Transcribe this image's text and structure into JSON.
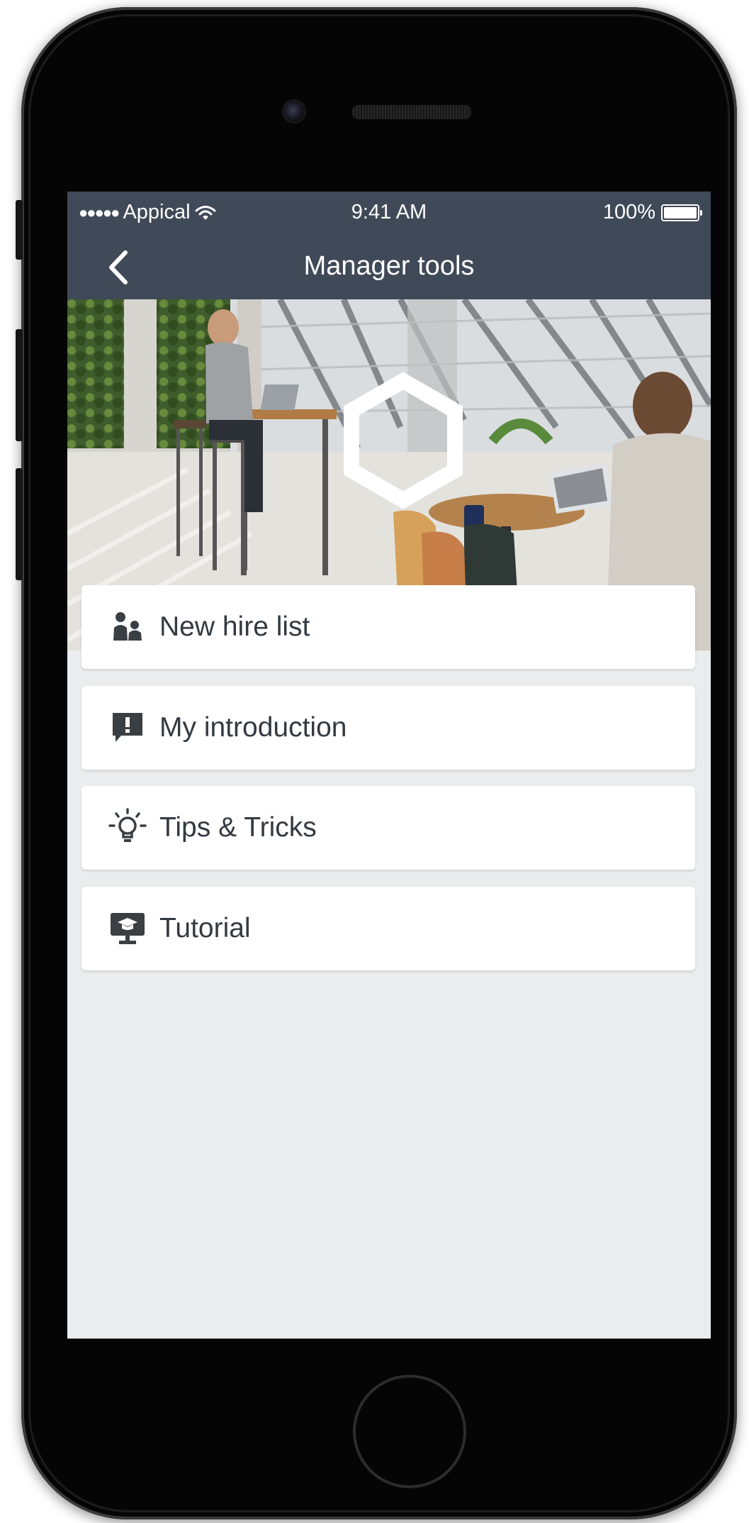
{
  "status_bar": {
    "signal_dots": "●●●●●",
    "carrier": "Appical",
    "time": "9:41 AM",
    "battery": "100%",
    "battery_level": 1.0
  },
  "nav": {
    "title": "Manager tools",
    "back_icon": "chevron-left-icon"
  },
  "hero": {
    "logo_icon": "hexagon-logo"
  },
  "menu": {
    "items": [
      {
        "label": "New hire list",
        "icon": "people-icon"
      },
      {
        "label": "My introduction",
        "icon": "speech-bubble-exclamation-icon"
      },
      {
        "label": "Tips & Tricks",
        "icon": "lightbulb-icon"
      },
      {
        "label": "Tutorial",
        "icon": "presentation-screen-icon"
      }
    ]
  },
  "colors": {
    "nav_background": "#404957",
    "screen_background": "#ebecee",
    "card_background": "#ffffff",
    "text": "#333a41",
    "icon": "#3a3f44"
  }
}
